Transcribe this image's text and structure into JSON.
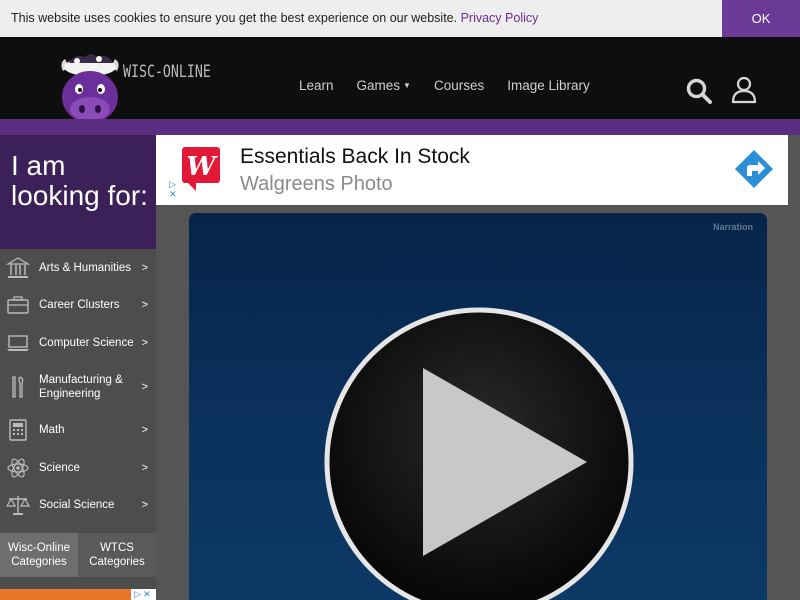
{
  "cookie_bar": {
    "message": "This website uses cookies to ensure you get the best experience on our website.",
    "link_label": "Privacy Policy",
    "ok_label": "OK"
  },
  "header": {
    "logo_text": "WISC-ONLINE",
    "nav": [
      {
        "label": "Learn",
        "has_dropdown": false
      },
      {
        "label": "Games",
        "has_dropdown": true
      },
      {
        "label": "Courses",
        "has_dropdown": false
      },
      {
        "label": "Image Library",
        "has_dropdown": false
      }
    ],
    "icons": [
      "search-icon",
      "user-icon"
    ]
  },
  "sidebar": {
    "heading": "I am looking for:",
    "categories": [
      {
        "label": "Arts & Humanities",
        "icon": "museum-icon",
        "arrow": ">"
      },
      {
        "label": "Career Clusters",
        "icon": "briefcase-icon",
        "arrow": ">"
      },
      {
        "label": "Computer Science",
        "icon": "laptop-icon",
        "arrow": ">"
      },
      {
        "label": "Manufacturing & Engineering",
        "icon": "tools-icon",
        "arrow": ">"
      },
      {
        "label": "Math",
        "icon": "calculator-icon",
        "arrow": ">"
      },
      {
        "label": "Science",
        "icon": "atom-icon",
        "arrow": ">"
      },
      {
        "label": "Social Science",
        "icon": "scales-icon",
        "arrow": ">"
      }
    ],
    "tabs": [
      {
        "label": "Wisc-Online Categories",
        "active": true
      },
      {
        "label": "WTCS Categories",
        "active": false
      }
    ]
  },
  "ad": {
    "title": "Essentials Back In Stock",
    "subtitle": "Walgreens Photo",
    "brand_letter": "W"
  },
  "player": {
    "narration_label": "Narration"
  },
  "colors": {
    "brand_purple": "#5a2f82",
    "sidebar_heading": "#3c2158",
    "ok_button": "#6b3a96",
    "player_blue": "#0a2f5a"
  }
}
